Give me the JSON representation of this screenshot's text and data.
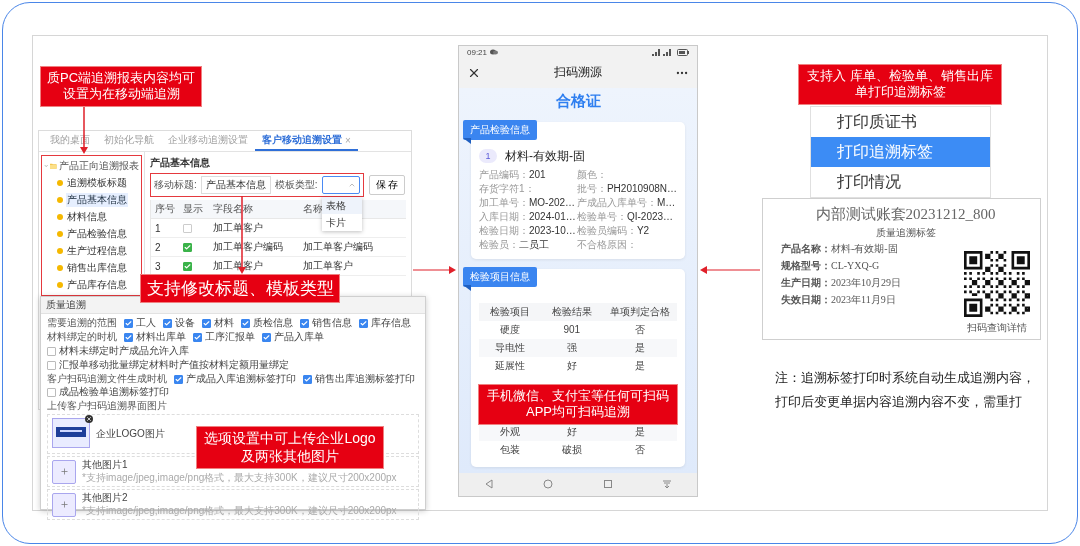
{
  "callouts": [
    {
      "text": "质PC端追溯报表内容均可设置为在移动端追溯"
    },
    {
      "text": "支持修改标题、模板类型"
    },
    {
      "text": "选项设置中可上传企业Logo及两张其他图片"
    },
    {
      "text": "手机微信、支付宝等任何可扫码APP均可扫码追溯"
    },
    {
      "text": "支持入 库单、检验单、销售出库单打印追溯标签"
    }
  ],
  "pc_window": {
    "tabs": [
      {
        "label": "我的桌面",
        "selected": false
      },
      {
        "label": "初始化导航",
        "selected": false
      },
      {
        "label": "企业移动追溯设置",
        "selected": false
      },
      {
        "label": "客户移动追溯设置",
        "selected": true,
        "close": "×"
      }
    ],
    "tree": {
      "label": "产品正向追溯报表",
      "expanded": true,
      "children": [
        {
          "label": "追溯模板标题",
          "selected": false
        },
        {
          "label": "产品基本信息",
          "selected": true
        },
        {
          "label": "材料信息",
          "selected": false
        },
        {
          "label": "产品检验信息",
          "selected": false
        },
        {
          "label": "生产过程信息",
          "selected": false
        },
        {
          "label": "销售出库信息",
          "selected": false
        },
        {
          "label": "产品库存信息",
          "selected": false
        }
      ]
    },
    "form": {
      "section": "产品基本信息",
      "title_label": "移动标题:",
      "title_value": "产品基本信息",
      "type_label": "模板类型:",
      "expanded": true,
      "type_options": [
        {
          "label": "表格",
          "selected": true
        },
        {
          "label": "卡片",
          "selected": false
        }
      ],
      "save": "保 存"
    },
    "table": {
      "columns": [
        "序号",
        "显示",
        "字段名称",
        "名称"
      ],
      "rows": [
        {
          "index": "1",
          "shown": false,
          "field": "加工单客户"
        },
        {
          "index": "2",
          "shown": true,
          "field": "加工单客户编码",
          "name": "加工单客户编码"
        },
        {
          "index": "3",
          "shown": true,
          "field": "加工单客户",
          "name": "加工单客户"
        }
      ]
    }
  },
  "options_dialog": {
    "title": "质量追溯",
    "groups": [
      {
        "label": "需要追溯的范围",
        "options": [
          {
            "label": "工人",
            "checked": true
          },
          {
            "label": "设备",
            "checked": true
          },
          {
            "label": "材料",
            "checked": true
          },
          {
            "label": "质检信息",
            "checked": true
          },
          {
            "label": "销售信息",
            "checked": true
          },
          {
            "label": "库存信息",
            "checked": true
          }
        ]
      },
      {
        "label": "材料绑定的时机",
        "options": [
          {
            "label": "材料出库单",
            "checked": true
          },
          {
            "label": "工序汇报单",
            "checked": true
          },
          {
            "label": "产品入库单",
            "checked": true
          }
        ]
      },
      {
        "options": [
          {
            "label": "材料未绑定时产成品允许入库",
            "checked": false
          }
        ]
      },
      {
        "options": [
          {
            "label": "汇报单移动批量绑定材料时产值按材料定额用量绑定",
            "checked": false
          }
        ]
      },
      {
        "label": "客户扫码追溯文件生成时机",
        "options": [
          {
            "label": "产成品入库追溯标签打印",
            "checked": true
          },
          {
            "label": "销售出库追溯标签打印",
            "checked": true
          },
          {
            "label": "成品检验单追溯标签打印",
            "checked": false
          }
        ]
      }
    ],
    "upload_label": "上传客户扫码追溯界面图片",
    "uploads": [
      {
        "kind": "logo",
        "label": "企业LOGO图片"
      },
      {
        "kind": "empty",
        "label": "其他图片1",
        "hint": "*支持image/jpeg,image/png格式，最大支持300K，建议尺寸200x200px"
      },
      {
        "kind": "empty",
        "label": "其他图片2",
        "hint": "*支持image/jpeg,image/png格式，最大支持300K，建议尺寸200x200px"
      }
    ]
  },
  "phone": {
    "time": "09:21",
    "title": "扫码溯源",
    "heading": "合格证",
    "product_card": {
      "tag": "产品检验信息",
      "number": "1",
      "name": "材料-有效期-固",
      "fields": [
        {
          "label": "产品编码：",
          "value": "201"
        },
        {
          "label": "颜色："
        },
        {
          "label": "存货字符1："
        },
        {
          "label": "批号：",
          "value": "PH2010908N…"
        },
        {
          "label": "加工单号：",
          "value": "MO-202…"
        },
        {
          "label": "产成品入库单号：",
          "value": "M…"
        },
        {
          "label": "入库日期：",
          "value": "2024-01…"
        },
        {
          "label": "检验单号：",
          "value": "QI-2023…"
        },
        {
          "label": "检验日期：",
          "value": "2023-10…"
        },
        {
          "label": "检验员编码：",
          "value": "Y2"
        },
        {
          "label": "检验员：",
          "value": "二员工"
        },
        {
          "label": "不合格原因："
        }
      ]
    },
    "inspection_card": {
      "tag": "检验项目信息",
      "columns": [
        "检验项目",
        "检验结果",
        "单项判定合格"
      ],
      "rows": [
        [
          "硬度",
          "901",
          "否"
        ],
        [
          "导电性",
          "强",
          "是"
        ],
        [
          "延展性",
          "好",
          "是"
        ],
        [
          "外观",
          "好",
          "是"
        ],
        [
          "包装",
          "破损",
          "否"
        ]
      ]
    }
  },
  "print_menu": {
    "items": [
      {
        "label": "打印质证书",
        "selected": false
      },
      {
        "label": "打印追溯标签",
        "selected": true
      },
      {
        "label": "打印情况",
        "selected": false
      }
    ]
  },
  "trace_label": {
    "title": "内部测试账套20231212_800",
    "subtitle": "质量追溯标签",
    "fields": [
      {
        "label": "产品名称：",
        "value": "材料-有效期-固"
      },
      {
        "label": "规格型号：",
        "value": "CL-YXQ-G"
      },
      {
        "label": "生产日期：",
        "value": "2023年10月29日"
      },
      {
        "label": "失效日期：",
        "value": "2023年11月9日"
      }
    ],
    "qr_caption": "扫码查询详情"
  },
  "note": "注：追溯标签打印时系统自动生成追溯内容，打印后变更单据内容追溯内容不变，需重打"
}
